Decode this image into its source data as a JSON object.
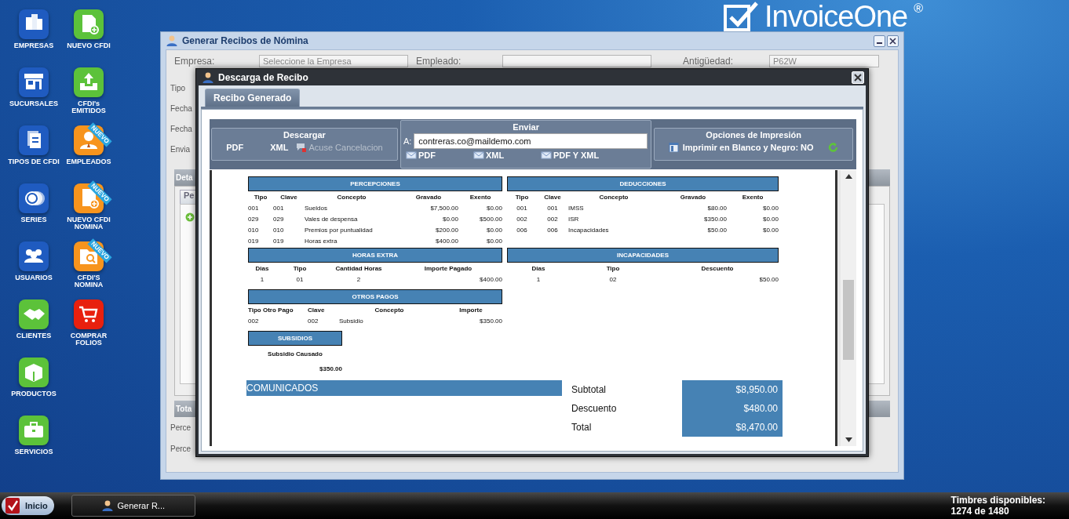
{
  "logo": {
    "name": "InvoiceOne",
    "mark": "®"
  },
  "desktop_icons": {
    "column_1": [
      {
        "label": "EMPRESAS",
        "color": "#1f5bc0"
      },
      {
        "label": "SUCURSALES",
        "color": "#1f5bc0"
      },
      {
        "label": "TIPOS DE CFDI",
        "color": "#1f5bc0"
      },
      {
        "label": "SERIES",
        "color": "#1f5bc0"
      },
      {
        "label": "USUARIOS",
        "color": "#1f5bc0"
      },
      {
        "label": "CLIENTES",
        "color": "#5cc23a"
      },
      {
        "label": "PRODUCTOS",
        "color": "#5cc23a"
      },
      {
        "label": "SERVICIOS",
        "color": "#5cc23a"
      }
    ],
    "column_2": [
      {
        "label": "NUEVO CFDI",
        "color": "#5cc23a"
      },
      {
        "label": "CFDI's\nEMITIDOS",
        "color": "#5cc23a"
      },
      {
        "label": "EMPLEADOS",
        "color": "#f7941d",
        "badge": "NUEVO"
      },
      {
        "label": "NUEVO CFDI\nNOMINA",
        "color": "#f7941d",
        "badge": "NUEVO"
      },
      {
        "label": "CFDI'S\nNOMINA",
        "color": "#f7941d",
        "badge": "NUEVO"
      },
      {
        "label": "COMPRAR\nFOLIOS",
        "color": "#e8200e"
      }
    ]
  },
  "background_window": {
    "title": "Generar Recibos de Nómina",
    "top_fields": [
      {
        "label": "Empresa:",
        "value": "Seleccione la Empresa"
      },
      {
        "label": "Empleado:"
      },
      {
        "label": "Antigüedad:",
        "value": "P62W"
      }
    ],
    "form_labels": [
      "Tipo",
      "Fecha",
      "Fecha",
      "Envia"
    ],
    "detail_panel": {
      "title": "Deta",
      "tab": "Pe"
    },
    "totals_panel": {
      "title": "Tota",
      "labels": [
        "Perce",
        "Perce"
      ]
    }
  },
  "dialog": {
    "title": "Descarga de Recibo",
    "tabs": [
      {
        "label": "Recibo Generado",
        "selected": true
      }
    ],
    "download": {
      "title": "Descargar",
      "links": [
        "PDF",
        "XML"
      ],
      "cancel_receipt": {
        "label": "Acuse Cancelacion",
        "disabled": true
      }
    },
    "send": {
      "title": "Enviar",
      "to_label": "A:",
      "email": "contreras.co@maildemo.com",
      "buttons": [
        "PDF",
        "XML",
        "PDF Y XML"
      ]
    },
    "print_options": {
      "title": "Opciones de Impresión",
      "option": "Imprimir en Blanco y Negro: NO"
    },
    "receipt": {
      "earnings": {
        "title": "PERCEPCIONES",
        "columns": [
          "Tipo",
          "Clave",
          "Concepto",
          "Gravado",
          "Exento"
        ],
        "rows": [
          [
            "001",
            "001",
            "Sueldos",
            "$7,500.00",
            "$0.00"
          ],
          [
            "029",
            "029",
            "Vales de despensa",
            "$0.00",
            "$500.00"
          ],
          [
            "010",
            "010",
            "Premios por puntualidad",
            "$200.00",
            "$0.00"
          ],
          [
            "019",
            "019",
            "Horas extra",
            "$400.00",
            "$0.00"
          ]
        ]
      },
      "deductions": {
        "title": "DEDUCCIONES",
        "columns": [
          "Tipo",
          "Clave",
          "Concepto",
          "Gravado",
          "Exento"
        ],
        "rows": [
          [
            "001",
            "001",
            "IMSS",
            "$80.00",
            "$0.00"
          ],
          [
            "002",
            "002",
            "ISR",
            "$350.00",
            "$0.00"
          ],
          [
            "006",
            "006",
            "Incapacidades",
            "$50.00",
            "$0.00"
          ]
        ]
      },
      "overtime": {
        "title": "HORAS EXTRA",
        "columns": [
          "Dias",
          "Tipo",
          "Cantidad Horas",
          "Importe Pagado"
        ],
        "rows": [
          [
            "1",
            "01",
            "2",
            "$400.00"
          ]
        ]
      },
      "disabilities": {
        "title": "INCAPACIDADES",
        "columns": [
          "Dias",
          "Tipo",
          "Descuento"
        ],
        "rows": [
          [
            "1",
            "02",
            "$50.00"
          ]
        ]
      },
      "other_payments": {
        "title": "OTROS PAGOS",
        "columns": [
          "Tipo Otro Pago",
          "Clave",
          "Concepto",
          "Importe"
        ],
        "rows": [
          [
            "002",
            "002",
            "Subsidio",
            "$350.00"
          ]
        ]
      },
      "subsidies": {
        "title": "SUBSIDIOS",
        "columns": [
          "Subsidio Causado"
        ],
        "rows": [
          [
            "$350.00"
          ]
        ]
      },
      "notices": {
        "title": "COMUNICADOS"
      },
      "totals": [
        {
          "label": "Subtotal",
          "value": "$8,950.00"
        },
        {
          "label": "Descuento",
          "value": "$480.00"
        },
        {
          "label": "Total",
          "value": "$8,470.00"
        }
      ]
    }
  },
  "taskbar": {
    "start": "Inicio",
    "windows": [
      "Generar R..."
    ],
    "stamps_label": "Timbres disponibles:",
    "stamps_value": "1274 de 1480"
  }
}
